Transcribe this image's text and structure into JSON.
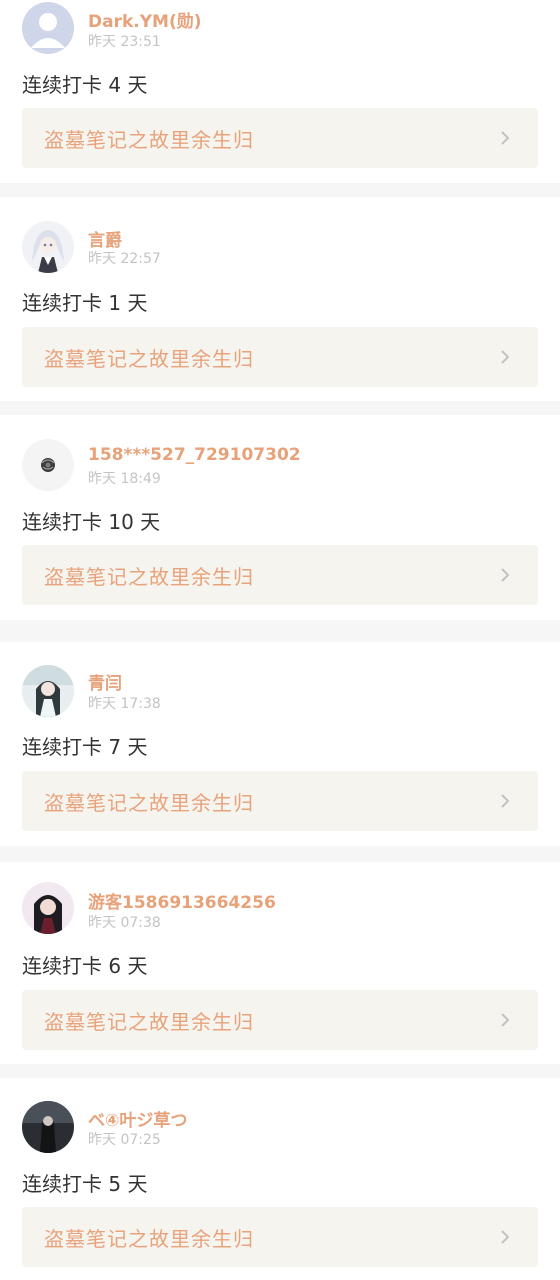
{
  "posts": [
    {
      "username": "Dark.YM(勋)",
      "time": "昨天 23:51",
      "checkin": "连续打卡 4 天",
      "book_title": "盗墓笔记之故里余生归",
      "avatar": "default-avatar-icon"
    },
    {
      "username": "言爵",
      "time": "昨天 22:57",
      "checkin": "连续打卡 1 天",
      "book_title": "盗墓笔记之故里余生归",
      "avatar": "anime-girl-avatar"
    },
    {
      "username": "158***527_729107302",
      "time": "昨天 18:49",
      "checkin": "连续打卡 10 天",
      "book_title": "盗墓笔记之故里余生归",
      "avatar": "rose-avatar"
    },
    {
      "username": "青闫",
      "time": "昨天 17:38",
      "checkin": "连续打卡 7 天",
      "book_title": "盗墓笔记之故里余生归",
      "avatar": "cosplay-avatar"
    },
    {
      "username": "游客1586913664256",
      "time": "昨天 07:38",
      "checkin": "连续打卡 6 天",
      "book_title": "盗墓笔记之故里余生归",
      "avatar": "dark-hair-avatar"
    },
    {
      "username": "ベ④叶ジ草つ",
      "time": "昨天 07:25",
      "checkin": "连续打卡 5 天",
      "book_title": "盗墓笔记之故里余生归",
      "avatar": "dark-scene-avatar"
    }
  ],
  "colors": {
    "username": "#e7a27a",
    "book_title": "#e9a37c",
    "book_bg": "#f5f4ee",
    "divider": "#f6f6f6"
  }
}
